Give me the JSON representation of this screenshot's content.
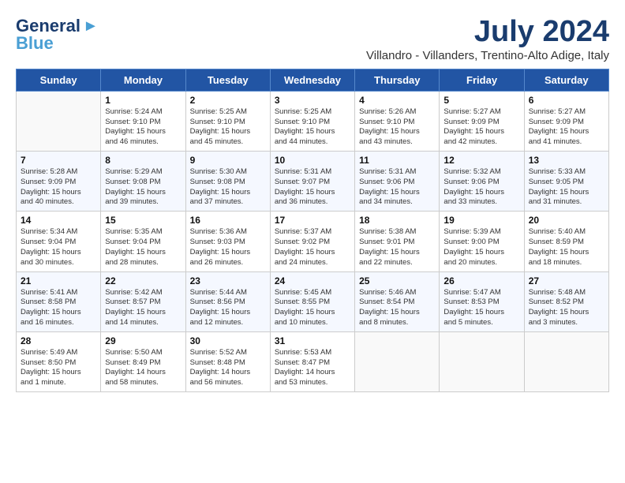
{
  "logo": {
    "line1": "General",
    "line2": "Blue"
  },
  "title": "July 2024",
  "subtitle": "Villandro - Villanders, Trentino-Alto Adige, Italy",
  "days_header": [
    "Sunday",
    "Monday",
    "Tuesday",
    "Wednesday",
    "Thursday",
    "Friday",
    "Saturday"
  ],
  "weeks": [
    [
      {
        "day": "",
        "info": ""
      },
      {
        "day": "1",
        "info": "Sunrise: 5:24 AM\nSunset: 9:10 PM\nDaylight: 15 hours\nand 46 minutes."
      },
      {
        "day": "2",
        "info": "Sunrise: 5:25 AM\nSunset: 9:10 PM\nDaylight: 15 hours\nand 45 minutes."
      },
      {
        "day": "3",
        "info": "Sunrise: 5:25 AM\nSunset: 9:10 PM\nDaylight: 15 hours\nand 44 minutes."
      },
      {
        "day": "4",
        "info": "Sunrise: 5:26 AM\nSunset: 9:10 PM\nDaylight: 15 hours\nand 43 minutes."
      },
      {
        "day": "5",
        "info": "Sunrise: 5:27 AM\nSunset: 9:09 PM\nDaylight: 15 hours\nand 42 minutes."
      },
      {
        "day": "6",
        "info": "Sunrise: 5:27 AM\nSunset: 9:09 PM\nDaylight: 15 hours\nand 41 minutes."
      }
    ],
    [
      {
        "day": "7",
        "info": "Sunrise: 5:28 AM\nSunset: 9:09 PM\nDaylight: 15 hours\nand 40 minutes."
      },
      {
        "day": "8",
        "info": "Sunrise: 5:29 AM\nSunset: 9:08 PM\nDaylight: 15 hours\nand 39 minutes."
      },
      {
        "day": "9",
        "info": "Sunrise: 5:30 AM\nSunset: 9:08 PM\nDaylight: 15 hours\nand 37 minutes."
      },
      {
        "day": "10",
        "info": "Sunrise: 5:31 AM\nSunset: 9:07 PM\nDaylight: 15 hours\nand 36 minutes."
      },
      {
        "day": "11",
        "info": "Sunrise: 5:31 AM\nSunset: 9:06 PM\nDaylight: 15 hours\nand 34 minutes."
      },
      {
        "day": "12",
        "info": "Sunrise: 5:32 AM\nSunset: 9:06 PM\nDaylight: 15 hours\nand 33 minutes."
      },
      {
        "day": "13",
        "info": "Sunrise: 5:33 AM\nSunset: 9:05 PM\nDaylight: 15 hours\nand 31 minutes."
      }
    ],
    [
      {
        "day": "14",
        "info": "Sunrise: 5:34 AM\nSunset: 9:04 PM\nDaylight: 15 hours\nand 30 minutes."
      },
      {
        "day": "15",
        "info": "Sunrise: 5:35 AM\nSunset: 9:04 PM\nDaylight: 15 hours\nand 28 minutes."
      },
      {
        "day": "16",
        "info": "Sunrise: 5:36 AM\nSunset: 9:03 PM\nDaylight: 15 hours\nand 26 minutes."
      },
      {
        "day": "17",
        "info": "Sunrise: 5:37 AM\nSunset: 9:02 PM\nDaylight: 15 hours\nand 24 minutes."
      },
      {
        "day": "18",
        "info": "Sunrise: 5:38 AM\nSunset: 9:01 PM\nDaylight: 15 hours\nand 22 minutes."
      },
      {
        "day": "19",
        "info": "Sunrise: 5:39 AM\nSunset: 9:00 PM\nDaylight: 15 hours\nand 20 minutes."
      },
      {
        "day": "20",
        "info": "Sunrise: 5:40 AM\nSunset: 8:59 PM\nDaylight: 15 hours\nand 18 minutes."
      }
    ],
    [
      {
        "day": "21",
        "info": "Sunrise: 5:41 AM\nSunset: 8:58 PM\nDaylight: 15 hours\nand 16 minutes."
      },
      {
        "day": "22",
        "info": "Sunrise: 5:42 AM\nSunset: 8:57 PM\nDaylight: 15 hours\nand 14 minutes."
      },
      {
        "day": "23",
        "info": "Sunrise: 5:44 AM\nSunset: 8:56 PM\nDaylight: 15 hours\nand 12 minutes."
      },
      {
        "day": "24",
        "info": "Sunrise: 5:45 AM\nSunset: 8:55 PM\nDaylight: 15 hours\nand 10 minutes."
      },
      {
        "day": "25",
        "info": "Sunrise: 5:46 AM\nSunset: 8:54 PM\nDaylight: 15 hours\nand 8 minutes."
      },
      {
        "day": "26",
        "info": "Sunrise: 5:47 AM\nSunset: 8:53 PM\nDaylight: 15 hours\nand 5 minutes."
      },
      {
        "day": "27",
        "info": "Sunrise: 5:48 AM\nSunset: 8:52 PM\nDaylight: 15 hours\nand 3 minutes."
      }
    ],
    [
      {
        "day": "28",
        "info": "Sunrise: 5:49 AM\nSunset: 8:50 PM\nDaylight: 15 hours\nand 1 minute."
      },
      {
        "day": "29",
        "info": "Sunrise: 5:50 AM\nSunset: 8:49 PM\nDaylight: 14 hours\nand 58 minutes."
      },
      {
        "day": "30",
        "info": "Sunrise: 5:52 AM\nSunset: 8:48 PM\nDaylight: 14 hours\nand 56 minutes."
      },
      {
        "day": "31",
        "info": "Sunrise: 5:53 AM\nSunset: 8:47 PM\nDaylight: 14 hours\nand 53 minutes."
      },
      {
        "day": "",
        "info": ""
      },
      {
        "day": "",
        "info": ""
      },
      {
        "day": "",
        "info": ""
      }
    ]
  ]
}
